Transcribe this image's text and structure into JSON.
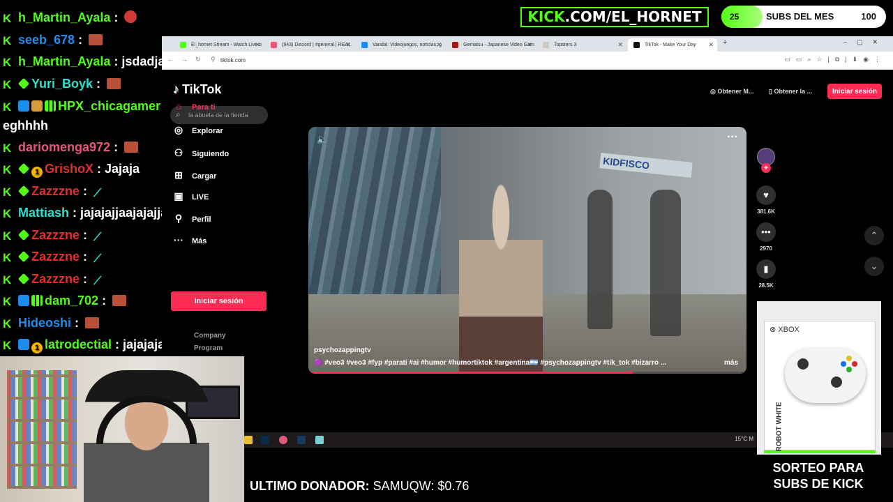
{
  "chat": [
    {
      "user": "h_Martin_Ayala",
      "color": "#53fc18",
      "badges": [],
      "emote": "red",
      "msg": ""
    },
    {
      "user": "seeb_678",
      "color": "#1c8ef0",
      "badges": [],
      "emote": "brown",
      "msg": ""
    },
    {
      "user": "h_Martin_Ayala",
      "color": "#53fc18",
      "badges": [],
      "emote": "",
      "msg": "jsdadjas"
    },
    {
      "user": "Yuri_Boyk",
      "color": "#2de0d0",
      "badges": [
        "diamond"
      ],
      "emote": "brown",
      "msg": ""
    },
    {
      "user": "HPX_chicagamer",
      "color": "#53fc18",
      "badges": [
        "blue",
        "box",
        "bars"
      ],
      "emote": "",
      "msg": "eghhhh"
    },
    {
      "user": "dariomenga972",
      "color": "#e8557a",
      "badges": [],
      "emote": "brown",
      "msg": ""
    },
    {
      "user": "GrishoX",
      "color": "#e0302e",
      "badges": [
        "diamond",
        "coin"
      ],
      "emote": "",
      "msg": "Jajaja"
    },
    {
      "user": "Zazzzne",
      "color": "#e0302e",
      "badges": [
        "diamond"
      ],
      "emote": "cyan",
      "msg": ""
    },
    {
      "user": "Mattiash",
      "color": "#2de0d0",
      "badges": [],
      "emote": "",
      "msg": "jajajajjaajajajjaja"
    },
    {
      "user": "Zazzzne",
      "color": "#e0302e",
      "badges": [
        "diamond"
      ],
      "emote": "cyan",
      "msg": ""
    },
    {
      "user": "Zazzzne",
      "color": "#e0302e",
      "badges": [
        "diamond"
      ],
      "emote": "cyan",
      "msg": ""
    },
    {
      "user": "Zazzzne",
      "color": "#e0302e",
      "badges": [
        "diamond"
      ],
      "emote": "cyan",
      "msg": ""
    },
    {
      "user": "dam_702",
      "color": "#53fc18",
      "badges": [
        "blue",
        "bars"
      ],
      "emote": "brown",
      "msg": ""
    },
    {
      "user": "Hideoshi",
      "color": "#1c8ef0",
      "badges": [],
      "emote": "brown",
      "msg": ""
    },
    {
      "user": "latrodectial",
      "color": "#53fc18",
      "badges": [
        "blue",
        "coin"
      ],
      "emote": "",
      "msg": "jajajaja"
    }
  ],
  "browser": {
    "tabs": [
      {
        "title": "El_hornet Stream - Watch Live o",
        "color": "#53fc18",
        "active": false
      },
      {
        "title": "(943) Discord | #general | REAL",
        "color": "#e8557a",
        "active": false
      },
      {
        "title": "Vandal: Videojuegos, noticias, g",
        "color": "#1c8ef0",
        "active": false
      },
      {
        "title": "Gematsu - Japanese Video Gam",
        "color": "#a01818",
        "active": false
      },
      {
        "title": "Topsters 3",
        "color": "#d0c7c0",
        "active": false
      },
      {
        "title": "TikTok - Make Your Day",
        "color": "#111111",
        "active": true
      }
    ],
    "url": "tiktok.com"
  },
  "tiktok": {
    "logo": "TikTok",
    "search_placeholder": "la abuela de la tienda",
    "nav": [
      {
        "label": "Para ti",
        "icon": "home-icon",
        "active": true
      },
      {
        "label": "Explorar",
        "icon": "compass-icon",
        "active": false
      },
      {
        "label": "Siguiendo",
        "icon": "user-follow-icon",
        "active": false
      },
      {
        "label": "Cargar",
        "icon": "upload-icon",
        "active": false
      },
      {
        "label": "LIVE",
        "icon": "live-icon",
        "active": false
      },
      {
        "label": "Perfil",
        "icon": "person-icon",
        "active": false
      },
      {
        "label": "Más",
        "icon": "more-icon",
        "active": false
      }
    ],
    "login_label": "Iniciar sesión",
    "footer": [
      "Company",
      "Program"
    ],
    "top_chips": [
      "Obtener M...",
      "Obtener la ..."
    ],
    "video": {
      "author": "psychozappingtv",
      "tags": "🟣 #veo3 #veo3 #fyp #parati #ai #humor #humortiktok #argentina🇦🇷 #psychozappingtv #tik_tok #bizarro ...",
      "more_label": "más",
      "sign_text": "KIDFISCO",
      "progress": 0.74
    },
    "actions": {
      "likes": "381.6K",
      "comments": "2970",
      "saves": "28.5K"
    }
  },
  "taskbar": {
    "weather": "15°C M"
  },
  "overlay": {
    "kick_url_prefix": "KICK",
    "kick_url_suffix": ".COM/EL_HORNET",
    "subs_count": "25",
    "subs_label": "SUBS DEL MES",
    "subs_goal": "100",
    "subs_progress": 0.25,
    "donor_label": "ULTIMO DONADOR:",
    "donor_value": "SAMUQW: $0.76",
    "giveaway_brand": "XBOX",
    "giveaway_product": "ROBOT WHITE",
    "giveaway_text": "SORTEO PARA SUBS DE KICK"
  },
  "colors": {
    "kick_green": "#53fc18",
    "tiktok_red": "#fe2c55"
  }
}
